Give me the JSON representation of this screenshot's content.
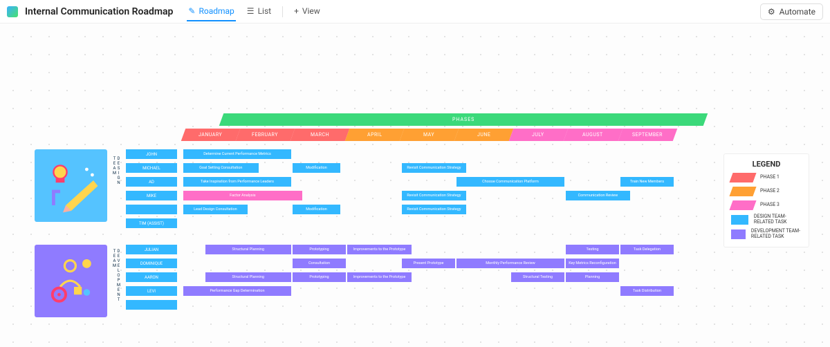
{
  "header": {
    "title": "Internal Communication Roadmap",
    "views": {
      "roadmap": "Roadmap",
      "list": "List",
      "add": "View"
    },
    "automate": "Automate"
  },
  "phases_banner": "PHASES",
  "months": [
    {
      "label": "JANUARY",
      "phase": "p1"
    },
    {
      "label": "FEBRUARY",
      "phase": "p1"
    },
    {
      "label": "MARCH",
      "phase": "p1"
    },
    {
      "label": "APRIL",
      "phase": "p2"
    },
    {
      "label": "MAY",
      "phase": "p2"
    },
    {
      "label": "JUNE",
      "phase": "p2"
    },
    {
      "label": "JULY",
      "phase": "p3"
    },
    {
      "label": "AUGUST",
      "phase": "p3"
    },
    {
      "label": "SEPTEMBER",
      "phase": "p3"
    }
  ],
  "teams": {
    "design": {
      "label": "DESIGN TEAM"
    },
    "dev": {
      "label": "DEVELOPMENT TEAM"
    }
  },
  "rowlabels": {
    "design": [
      "JOHN",
      "MICHAEL",
      "AD",
      "MIKE",
      "",
      "TIM (ASSIST)"
    ],
    "dev": [
      "JULIAN",
      "DOMINIQUE",
      "AARON",
      "LEVI",
      ""
    ]
  },
  "tasks": {
    "design": [
      {
        "row": 0,
        "start": 0,
        "span": 2.0,
        "color": "blue",
        "label": "Determine Current Performance Metrics"
      },
      {
        "row": 1,
        "start": 0,
        "span": 1.4,
        "color": "blue",
        "label": "Goal Setting Consultation"
      },
      {
        "row": 1,
        "start": 2,
        "span": 0.9,
        "color": "blue",
        "label": "Modification"
      },
      {
        "row": 1,
        "start": 4,
        "span": 1.2,
        "color": "blue",
        "label": "Revisit Communication Strategy"
      },
      {
        "row": 2,
        "start": 0,
        "span": 2.0,
        "color": "blue",
        "label": "Take Inspiration from Performance Leaders"
      },
      {
        "row": 2,
        "start": 5,
        "span": 2.0,
        "color": "blue",
        "label": "Choose Communication Platform"
      },
      {
        "row": 2,
        "start": 8,
        "span": 1.0,
        "color": "blue",
        "label": "Train New Members"
      },
      {
        "row": 3,
        "start": 0,
        "span": 2.2,
        "color": "pink",
        "label": "Factor Analysis"
      },
      {
        "row": 3,
        "start": 4,
        "span": 1.2,
        "color": "blue",
        "label": "Revisit Communication Strategy"
      },
      {
        "row": 3,
        "start": 7,
        "span": 1.2,
        "color": "blue",
        "label": "Communication Review"
      },
      {
        "row": 4,
        "start": 0,
        "span": 1.2,
        "color": "blue",
        "label": "Lead Design Consultation"
      },
      {
        "row": 4,
        "start": 2,
        "span": 0.9,
        "color": "blue",
        "label": "Modification"
      },
      {
        "row": 4,
        "start": 4,
        "span": 1.2,
        "color": "blue",
        "label": "Revisit Communication Strategy"
      }
    ],
    "dev": [
      {
        "row": 0,
        "start": 0.4,
        "span": 1.6,
        "color": "purple",
        "label": "Structural Planning"
      },
      {
        "row": 0,
        "start": 2,
        "span": 1.0,
        "color": "purple",
        "label": "Prototyping"
      },
      {
        "row": 0,
        "start": 3,
        "span": 1.2,
        "color": "purple",
        "label": "Improvements to the Prototype"
      },
      {
        "row": 0,
        "start": 7,
        "span": 1.0,
        "color": "purple",
        "label": "Testing"
      },
      {
        "row": 0,
        "start": 8,
        "span": 1.0,
        "color": "purple",
        "label": "Task Delegation"
      },
      {
        "row": 1,
        "start": 2,
        "span": 1.0,
        "color": "purple",
        "label": "Consultation"
      },
      {
        "row": 1,
        "start": 4,
        "span": 1.0,
        "color": "purple",
        "label": "Present Prototype"
      },
      {
        "row": 1,
        "start": 5,
        "span": 2.0,
        "color": "purple",
        "label": "Monthly Performance Review"
      },
      {
        "row": 1,
        "start": 7,
        "span": 1.0,
        "color": "purple",
        "label": "Key Metrics Reconfiguration"
      },
      {
        "row": 2,
        "start": 0.4,
        "span": 1.6,
        "color": "purple",
        "label": "Structural Planning"
      },
      {
        "row": 2,
        "start": 2,
        "span": 1.0,
        "color": "purple",
        "label": "Prototyping"
      },
      {
        "row": 2,
        "start": 3,
        "span": 1.2,
        "color": "purple",
        "label": "Improvements to the Prototype"
      },
      {
        "row": 2,
        "start": 6,
        "span": 1.0,
        "color": "purple",
        "label": "Structural Testing"
      },
      {
        "row": 2,
        "start": 7,
        "span": 1.0,
        "color": "purple",
        "label": "Planning"
      },
      {
        "row": 3,
        "start": 0,
        "span": 2.0,
        "color": "purple",
        "label": "Performance Gap Determination"
      },
      {
        "row": 3,
        "start": 8,
        "span": 1.0,
        "color": "purple",
        "label": "Task Distribution"
      }
    ]
  },
  "legend": {
    "title": "LEGEND",
    "items": [
      {
        "color": "#ff6b6b",
        "shape": "para",
        "label": "PHASE 1"
      },
      {
        "color": "#ffa033",
        "shape": "para",
        "label": "PHASE 2"
      },
      {
        "color": "#ff6ec7",
        "shape": "para",
        "label": "PHASE 3"
      },
      {
        "color": "#33b8ff",
        "shape": "rect",
        "label": "DESIGN TEAM-RELATED TASK"
      },
      {
        "color": "#8f7bff",
        "shape": "rect",
        "label": "DEVELOPMENT TEAM-RELATED TASK"
      }
    ]
  }
}
